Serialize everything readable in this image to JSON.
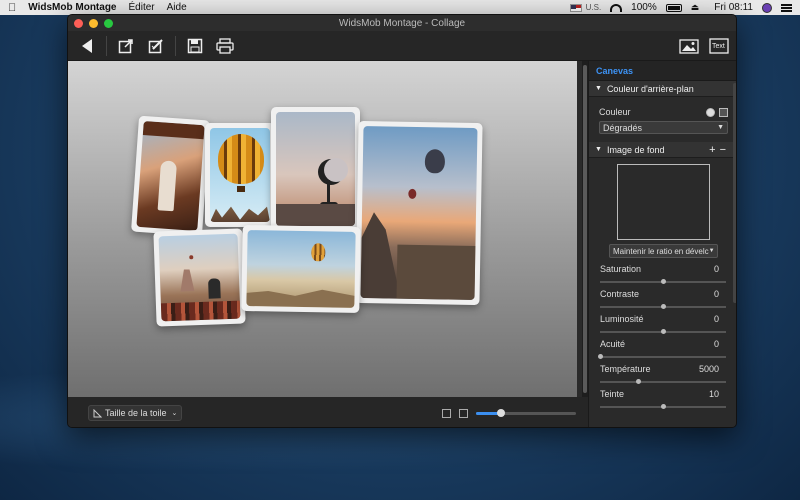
{
  "menubar": {
    "app_name": "WidsMob Montage",
    "menus": [
      "Éditer",
      "Aide"
    ],
    "locale": "U.S.",
    "battery": "100%",
    "clock": "Fri 08:11"
  },
  "window": {
    "title": "WidsMob Montage - Collage",
    "toolbar": {
      "icons": [
        "back-icon",
        "export-icon",
        "edit-icon",
        "save-icon",
        "print-icon",
        "add-image-icon",
        "add-text-icon"
      ],
      "text_button": "Text"
    }
  },
  "bottombar": {
    "canvas_size_label": "Taille de la toile",
    "zoom_level": 0.25
  },
  "panel": {
    "tab": "Canevas",
    "sections": {
      "background_color": {
        "title": "Couleur d'arrière-plan",
        "color_label": "Couleur",
        "gradient_value": "Dégradés"
      },
      "background_image": {
        "title": "Image de fond",
        "add": "+",
        "remove": "−",
        "ratio_value": "Maintenir le ratio en dévelc"
      }
    },
    "adjustments": [
      {
        "label": "Saturation",
        "value": "0",
        "position": 0.5
      },
      {
        "label": "Contraste",
        "value": "0",
        "position": 0.5
      },
      {
        "label": "Luminosité",
        "value": "0",
        "position": 0.5
      },
      {
        "label": "Acuité",
        "value": "0",
        "position": 0.0
      },
      {
        "label": "Température",
        "value": "5000",
        "position": 0.3
      },
      {
        "label": "Teinte",
        "value": "10",
        "position": 0.5
      }
    ]
  }
}
